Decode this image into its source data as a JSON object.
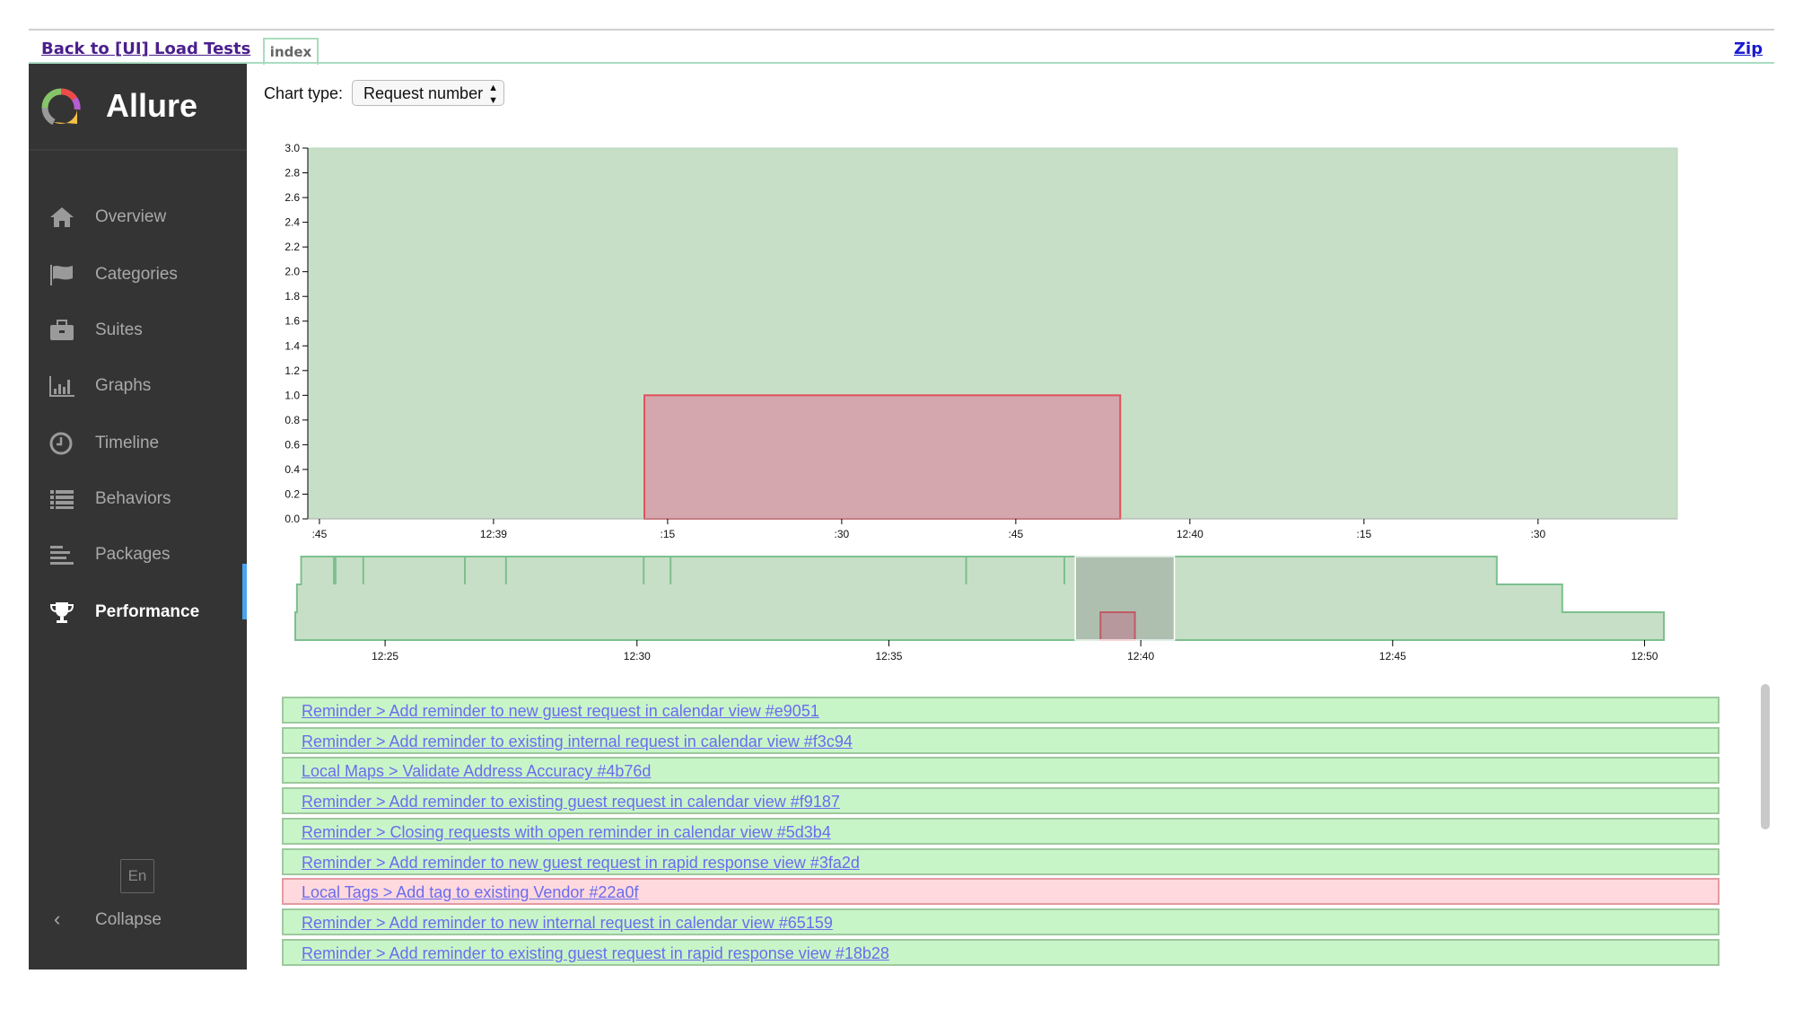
{
  "header": {
    "back_link": "Back to [UI] Load Tests",
    "tab": "index",
    "zip_link": "Zip"
  },
  "sidebar": {
    "brand": "Allure",
    "items": [
      {
        "label": "Overview",
        "icon": "home-icon"
      },
      {
        "label": "Categories",
        "icon": "flag-icon"
      },
      {
        "label": "Suites",
        "icon": "briefcase-icon"
      },
      {
        "label": "Graphs",
        "icon": "bar-chart-icon"
      },
      {
        "label": "Timeline",
        "icon": "clock-icon"
      },
      {
        "label": "Behaviors",
        "icon": "list-icon"
      },
      {
        "label": "Packages",
        "icon": "align-left-icon"
      },
      {
        "label": "Performance",
        "icon": "trophy-icon",
        "active": true
      }
    ],
    "language": "En",
    "collapse": "Collapse"
  },
  "controls": {
    "chart_type_label": "Chart type:",
    "chart_type_value": "Request number"
  },
  "colors": {
    "pass_fill": "#c7dfc7",
    "pass_stroke": "#7cc08e",
    "fail_fill": "#d3a7ad",
    "fail_stroke": "#e0505c",
    "accent": "#4aa3ef"
  },
  "chart_data": [
    {
      "type": "area",
      "xlim": [
        "12:38:44",
        "12:40:42"
      ],
      "ylim": [
        0,
        3.0
      ],
      "yticks": [
        "0.0",
        "0.2",
        "0.4",
        "0.6",
        "0.8",
        "1.0",
        "1.2",
        "1.4",
        "1.6",
        "1.8",
        "2.0",
        "2.2",
        "2.4",
        "2.6",
        "2.8",
        "3.0"
      ],
      "xticks": [
        {
          "t": "12:38:45",
          "label": ":45"
        },
        {
          "t": "12:39:00",
          "label": "12:39"
        },
        {
          "t": "12:39:15",
          "label": ":15"
        },
        {
          "t": "12:39:30",
          "label": ":30"
        },
        {
          "t": "12:39:45",
          "label": ":45"
        },
        {
          "t": "12:40:00",
          "label": "12:40"
        },
        {
          "t": "12:40:15",
          "label": ":15"
        },
        {
          "t": "12:40:30",
          "label": ":30"
        }
      ],
      "series": [
        {
          "status": "passed",
          "points": [
            [
              "12:38:44",
              3
            ],
            [
              "12:40:42",
              3
            ]
          ]
        },
        {
          "status": "failed",
          "points": [
            [
              "12:39:13",
              1
            ],
            [
              "12:39:54",
              1
            ]
          ]
        }
      ]
    },
    {
      "type": "area",
      "xlim": [
        "12:23:13",
        "12:50:23"
      ],
      "ylim": [
        0,
        3
      ],
      "xticks": [
        {
          "t": "12:25:00",
          "label": "12:25"
        },
        {
          "t": "12:30:00",
          "label": "12:30"
        },
        {
          "t": "12:35:00",
          "label": "12:35"
        },
        {
          "t": "12:40:00",
          "label": "12:40"
        },
        {
          "t": "12:45:00",
          "label": "12:45"
        },
        {
          "t": "12:50:00",
          "label": "12:50"
        }
      ],
      "passed_steps": [
        [
          "12:23:13",
          1
        ],
        [
          "12:23:15",
          2
        ],
        [
          "12:23:20",
          3
        ],
        [
          "12:47:04",
          2
        ],
        [
          "12:48:22",
          1
        ],
        [
          "12:50:23",
          1
        ]
      ],
      "passed_dips": [
        "12:23:59",
        "12:24:01",
        "12:24:34",
        "12:26:35",
        "12:27:24",
        "12:30:08",
        "12:30:40",
        "12:36:32",
        "12:38:29"
      ],
      "failed": [
        [
          "12:39:12",
          1
        ],
        [
          "12:39:53",
          1
        ]
      ],
      "selection": [
        "12:38:42",
        "12:40:40"
      ]
    }
  ],
  "tests": [
    {
      "name": "Reminder > Add reminder to new guest request in calendar view #e9051",
      "status": "passed"
    },
    {
      "name": "Reminder > Add reminder to existing internal request in calendar view #f3c94",
      "status": "passed"
    },
    {
      "name": "Local Maps > Validate Address Accuracy #4b76d",
      "status": "passed"
    },
    {
      "name": "Reminder > Add reminder to existing guest request in calendar view #f9187",
      "status": "passed"
    },
    {
      "name": "Reminder > Closing requests with open reminder in calendar view #5d3b4",
      "status": "passed"
    },
    {
      "name": "Reminder > Add reminder to new guest request in rapid response view #3fa2d",
      "status": "passed"
    },
    {
      "name": "Local Tags > Add tag to existing Vendor #22a0f",
      "status": "failed"
    },
    {
      "name": "Reminder > Add reminder to new internal request in calendar view #65159",
      "status": "passed"
    },
    {
      "name": "Reminder > Add reminder to existing guest request in rapid response view #18b28",
      "status": "passed"
    }
  ]
}
